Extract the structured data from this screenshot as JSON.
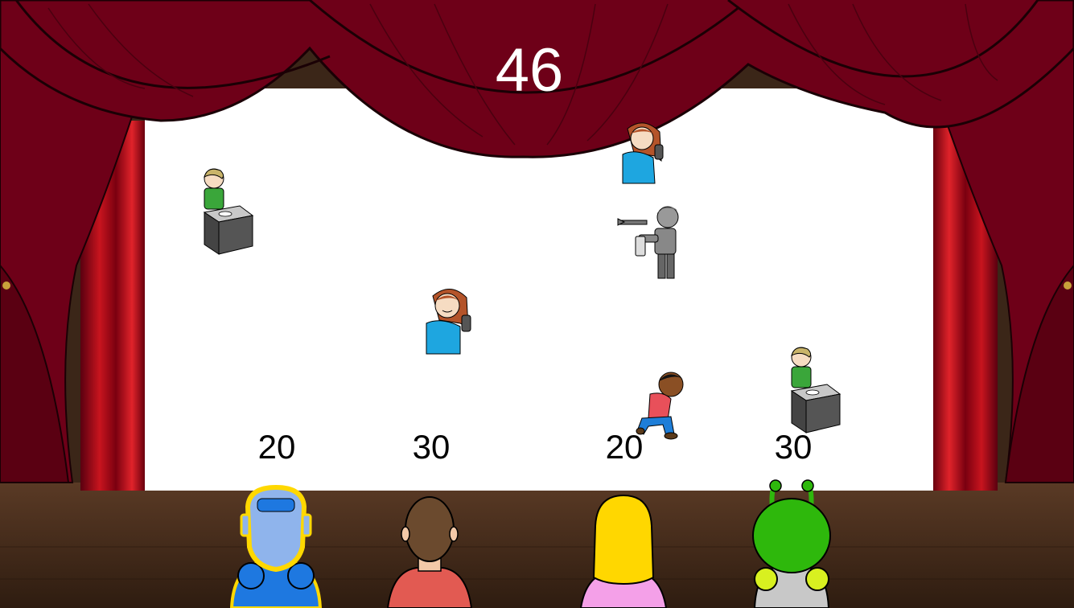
{
  "game": {
    "timer": "46",
    "scores": [
      {
        "player": "robot",
        "value": "20"
      },
      {
        "player": "boy",
        "value": "30"
      },
      {
        "player": "girl",
        "value": "20"
      },
      {
        "player": "alien",
        "value": "30"
      }
    ]
  },
  "colors": {
    "curtain": "#6e0018",
    "curtain_dark": "#4a0010",
    "screen": "#ffffff",
    "floor": "#4b2f1e",
    "timer_text": "#ffffff",
    "score_text": "#000000"
  },
  "sprites": [
    {
      "name": "boy-washing-hands-sprite",
      "active": true
    },
    {
      "name": "girl-brushing-hair-top-sprite",
      "active": true
    },
    {
      "name": "boy-pointing-hairdryer-sprite",
      "active": false
    },
    {
      "name": "girl-brushing-hair-sprite",
      "active": true
    },
    {
      "name": "boy-tying-shoes-sprite",
      "active": true
    },
    {
      "name": "boy-washing-hands-right-sprite",
      "active": true
    }
  ]
}
